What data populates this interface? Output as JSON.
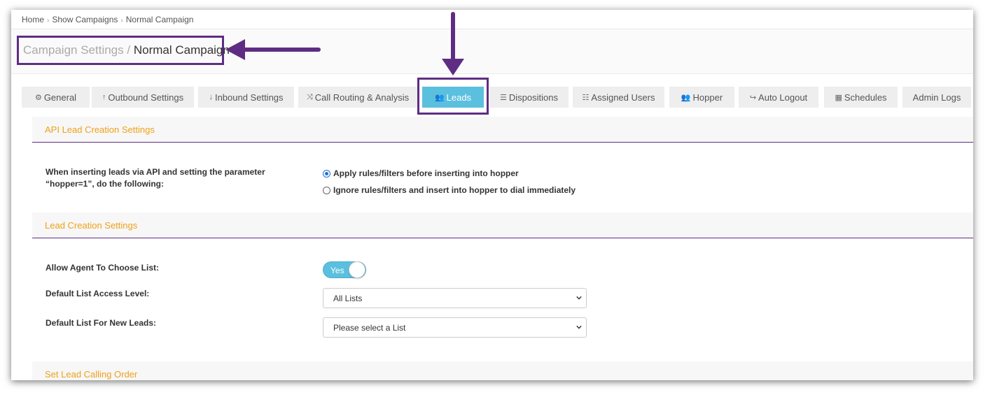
{
  "breadcrumb": {
    "items": [
      "Home",
      "Show Campaigns",
      "Normal Campaign"
    ]
  },
  "page_title": {
    "prefix": "Campaign Settings",
    "separator": "/",
    "name": "Normal Campaign"
  },
  "tabs": [
    {
      "label": "General",
      "icon": "gears-icon"
    },
    {
      "label": "Outbound Settings",
      "icon": "arrow-up-icon"
    },
    {
      "label": "Inbound Settings",
      "icon": "arrow-down-icon"
    },
    {
      "label": "Call Routing & Analysis",
      "icon": "shuffle-icon"
    },
    {
      "label": "Leads",
      "icon": "users-icon",
      "active": true
    },
    {
      "label": "Dispositions",
      "icon": "list-icon"
    },
    {
      "label": "Assigned Users",
      "icon": "ordered-list-icon"
    },
    {
      "label": "Hopper",
      "icon": "users-icon"
    },
    {
      "label": "Auto Logout",
      "icon": "sign-out-icon"
    },
    {
      "label": "Schedules",
      "icon": "calendar-icon"
    },
    {
      "label": "Admin Logs",
      "icon": ""
    }
  ],
  "sections": {
    "api": {
      "title": "API Lead Creation Settings",
      "label": "When inserting leads via API and setting the parameter “hopper=1”, do the following:",
      "options": [
        {
          "label": "Apply rules/filters before inserting into hopper",
          "checked": true
        },
        {
          "label": "Ignore rules/filters and insert into hopper to dial immediately",
          "checked": false
        }
      ]
    },
    "lead_creation": {
      "title": "Lead Creation Settings",
      "allow_agent_label": "Allow Agent To Choose List:",
      "allow_agent_toggle": "Yes",
      "access_level_label": "Default List Access Level:",
      "access_level_value": "All Lists",
      "new_leads_label": "Default List For New Leads:",
      "new_leads_value": "Please select a List"
    },
    "calling_order": {
      "title": "Set Lead Calling Order"
    }
  },
  "colors": {
    "accent": "#5bc0de",
    "annotation": "#5e2d83",
    "section_title": "#f0a019"
  }
}
